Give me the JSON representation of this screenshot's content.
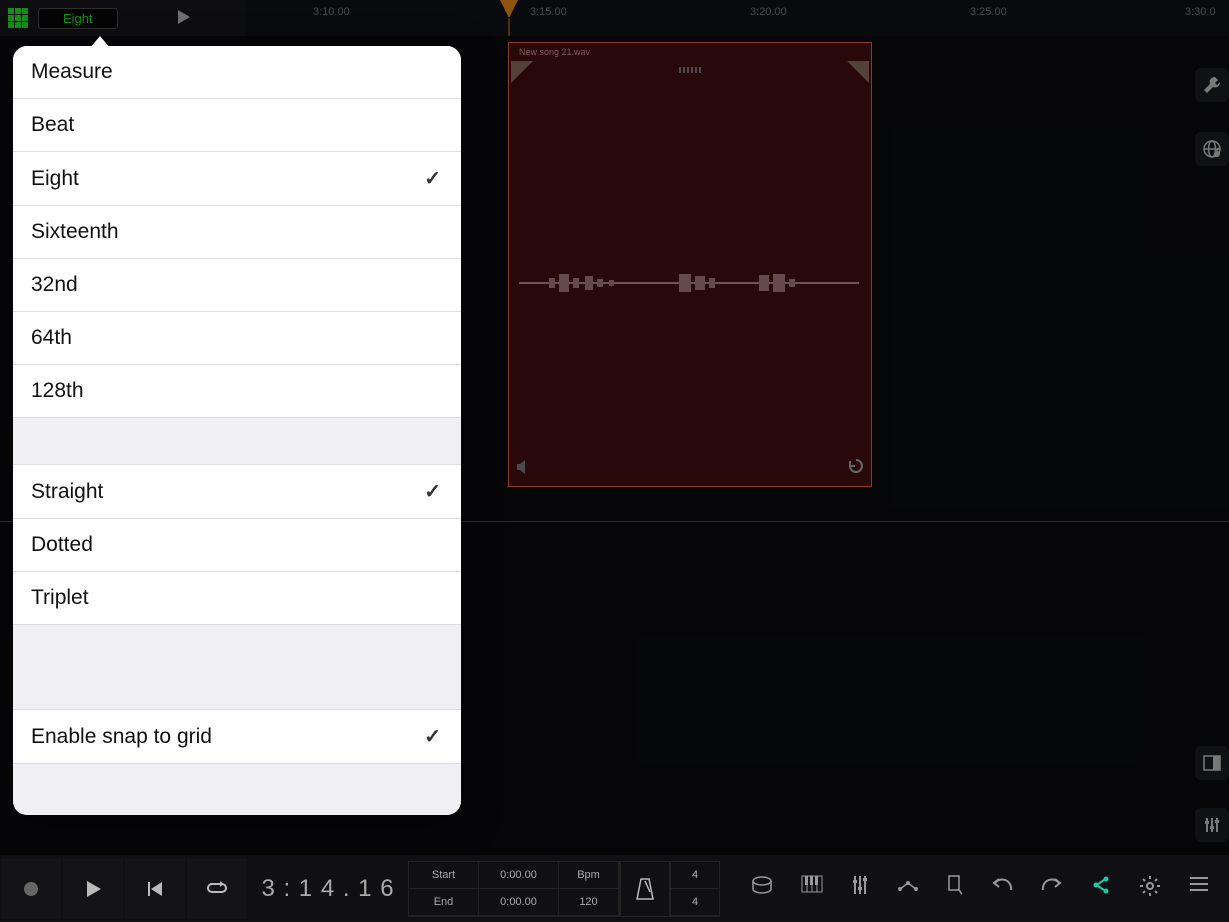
{
  "topbar": {
    "snap_value": "Eight"
  },
  "ruler": {
    "ticks": [
      "3:10.00",
      "3:15.00",
      "3:20.00",
      "3:25.00",
      "3:30.0"
    ],
    "tick_positions": [
      68,
      285,
      505,
      725,
      940
    ]
  },
  "clip": {
    "title": "New song 21.wav"
  },
  "popover": {
    "divisions": [
      {
        "label": "Measure",
        "checked": false
      },
      {
        "label": "Beat",
        "checked": false
      },
      {
        "label": "Eight",
        "checked": true
      },
      {
        "label": "Sixteenth",
        "checked": false
      },
      {
        "label": "32nd",
        "checked": false
      },
      {
        "label": "64th",
        "checked": false
      },
      {
        "label": "128th",
        "checked": false
      }
    ],
    "feels": [
      {
        "label": "Straight",
        "checked": true
      },
      {
        "label": "Dotted",
        "checked": false
      },
      {
        "label": "Triplet",
        "checked": false
      }
    ],
    "snap": {
      "label": "Enable snap to grid",
      "checked": true
    }
  },
  "transport": {
    "time": "3 : 1 4 . 1 6",
    "start_label": "Start",
    "start_value": "0:00.00",
    "end_label": "End",
    "end_value": "0:00.00",
    "bpm_label": "Bpm",
    "bpm_value": "120",
    "ts_top": "4",
    "ts_bottom": "4"
  },
  "icons": {
    "grid": "grid-icon",
    "wrench": "wrench-icon",
    "globe": "globe-music-icon",
    "panel": "panel-icon",
    "sliders": "sliders-icon",
    "record": "record-icon",
    "play": "play-icon",
    "rewind": "skip-start-icon",
    "loop": "loop-icon",
    "metronome": "metronome-icon",
    "drum": "drum-icon",
    "keyboard": "keyboard-icon",
    "mixer": "mixer-icon",
    "automation": "automation-icon",
    "marker": "marker-icon",
    "undo": "undo-icon",
    "redo": "redo-icon",
    "share": "share-icon",
    "settings": "settings-icon",
    "menu": "menu-icon",
    "speaker": "speaker-icon",
    "revert": "revert-icon"
  }
}
